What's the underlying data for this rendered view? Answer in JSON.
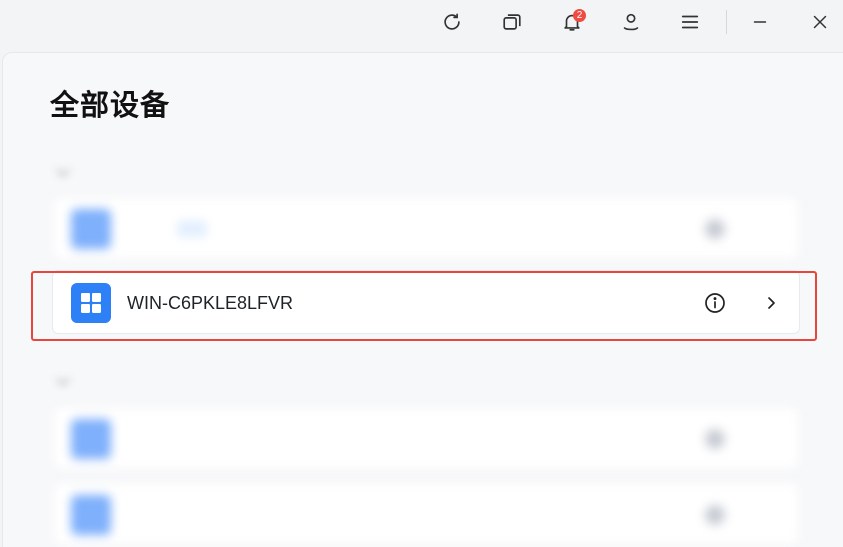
{
  "titlebar": {
    "icons": [
      "refresh-icon",
      "multi-window-icon",
      "bell-icon",
      "user-icon",
      "menu-icon",
      "minimize-icon",
      "close-icon"
    ],
    "notification_count": "2"
  },
  "page": {
    "title": "全部设备"
  },
  "groups": [
    {
      "label": ""
    },
    {
      "label": ""
    }
  ],
  "devices": {
    "selected": {
      "name": "WIN-C6PKLE8LFVR",
      "os_icon": "windows-icon"
    }
  },
  "colors": {
    "accent": "#2e80f7",
    "highlight": "#e8453c",
    "badge": "#f04a41",
    "background": "#f3f4f6",
    "card": "#ffffff"
  }
}
